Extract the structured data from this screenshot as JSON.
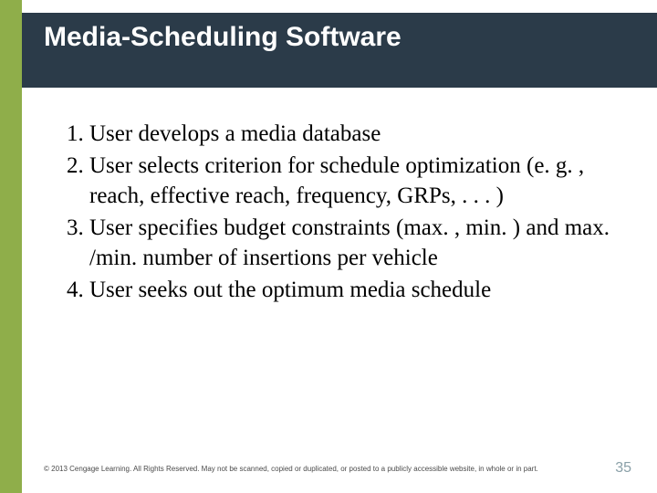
{
  "title": "Media-Scheduling Software",
  "list": {
    "item1": "User develops a media database",
    "item2": "User selects criterion for schedule optimization (e. g. , reach, effective reach, frequency, GRPs, . . . )",
    "item3": "User specifies budget constraints (max. , min. ) and max. /min. number of insertions per vehicle",
    "item4": "User seeks out the optimum media schedule"
  },
  "footer": "© 2013 Cengage Learning. All Rights Reserved. May not be scanned, copied or duplicated, or posted to a publicly accessible website, in whole or in part.",
  "page_number": "35"
}
